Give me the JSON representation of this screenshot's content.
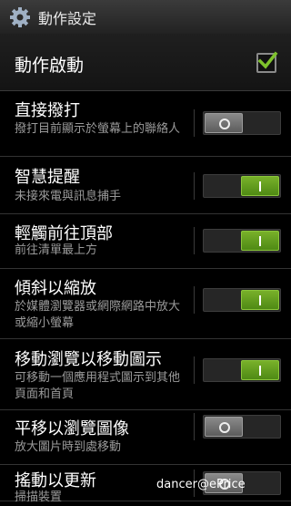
{
  "header": {
    "title": "動作設定",
    "icon": "gear-icon"
  },
  "master_toggle": {
    "label": "動作啟動",
    "checked": true,
    "accent": "#7ec22c"
  },
  "settings": [
    {
      "title": "直接撥打",
      "subtitle": "撥打目前顯示於螢幕上的聯絡人",
      "enabled": false
    },
    {
      "title": "智慧提醒",
      "subtitle": "未接來電與訊息捕手",
      "enabled": true
    },
    {
      "title": "輕觸前往頂部",
      "subtitle": "前往清單最上方",
      "enabled": true
    },
    {
      "title": "傾斜以縮放",
      "subtitle": "於媒體瀏覽器或網際網路中放大或縮小螢幕",
      "enabled": true
    },
    {
      "title": "移動瀏覽以移動圖示",
      "subtitle": "可移動一個應用程式圖示到其他頁面和首頁",
      "enabled": true
    },
    {
      "title": "平移以瀏覽圖像",
      "subtitle": "放大圖片時到處移動",
      "enabled": false
    },
    {
      "title": "搖動以更新",
      "subtitle": "掃描裝置",
      "enabled": false
    }
  ],
  "watermark": "dancer@ePrice"
}
